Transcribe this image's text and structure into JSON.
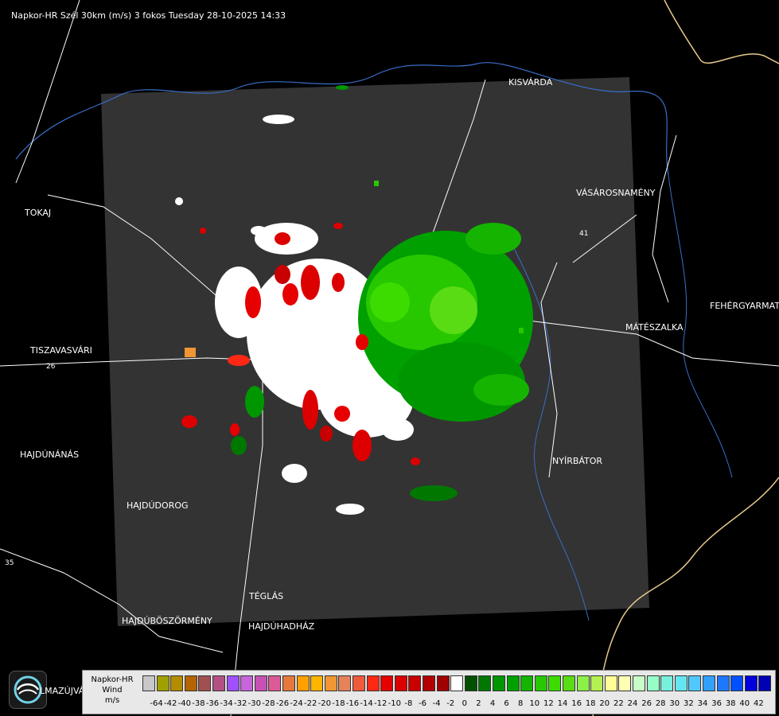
{
  "title": "Napkor-HR Szél 30km (m/s) 3 fokos Tuesday 28-10-2025 14:33",
  "towns": [
    {
      "name": "KISVÁRDA"
    },
    {
      "name": "TOKAJ"
    },
    {
      "name": "VÁSÁROSNAMÉNY"
    },
    {
      "name": "FEHÉRGYARMAT"
    },
    {
      "name": "TISZAVASVÁRI"
    },
    {
      "name": "MÁTÉSZALKA"
    },
    {
      "name": "HAJDÚNÁNÁS"
    },
    {
      "name": "NYÍRBÁTOR"
    },
    {
      "name": "HAJDÚDOROG"
    },
    {
      "name": "TÉGLÁS"
    },
    {
      "name": "HAJDÚBÖSZÖRMÉNY"
    },
    {
      "name": "HAJDÚHADHÁZ"
    }
  ],
  "road_labels": [
    "26",
    "35",
    "41"
  ],
  "logo_text": "LMAZÚJVÁR",
  "legend": {
    "label_line1": "Napkor-HR",
    "label_line2": "Wind",
    "label_line3": "m/s",
    "ticks": [
      "-64",
      "-42",
      "-40",
      "-38",
      "-36",
      "-34",
      "-32",
      "-30",
      "-28",
      "-26",
      "-24",
      "-22",
      "-20",
      "-18",
      "-16",
      "-14",
      "-12",
      "-10",
      "-8",
      "-6",
      "-4",
      "-2",
      "0",
      "2",
      "4",
      "6",
      "8",
      "10",
      "12",
      "14",
      "16",
      "18",
      "20",
      "22",
      "24",
      "26",
      "28",
      "30",
      "32",
      "34",
      "36",
      "38",
      "40",
      "42"
    ],
    "colors": [
      "#c8c8c8",
      "#a0a000",
      "#b48c00",
      "#b46400",
      "#a05050",
      "#b45082",
      "#a050ff",
      "#c864dc",
      "#c850b4",
      "#dc5a96",
      "#e6783c",
      "#ffa000",
      "#ffb400",
      "#f09632",
      "#e6825a",
      "#f05a3c",
      "#ff2814",
      "#e60000",
      "#dc0000",
      "#c80000",
      "#b40000",
      "#a00000",
      "#ffffff",
      "#005000",
      "#007800",
      "#009600",
      "#00a000",
      "#14b400",
      "#28c800",
      "#3cdc00",
      "#5adc14",
      "#8cf046",
      "#b4f050",
      "#ffff96",
      "#ffffb4",
      "#c8ffc8",
      "#96ffc8",
      "#78f0dc",
      "#64e6f0",
      "#50c8ff",
      "#32a0ff",
      "#1e78ff",
      "#0050ff",
      "#0000dc",
      "#0000b4"
    ]
  }
}
